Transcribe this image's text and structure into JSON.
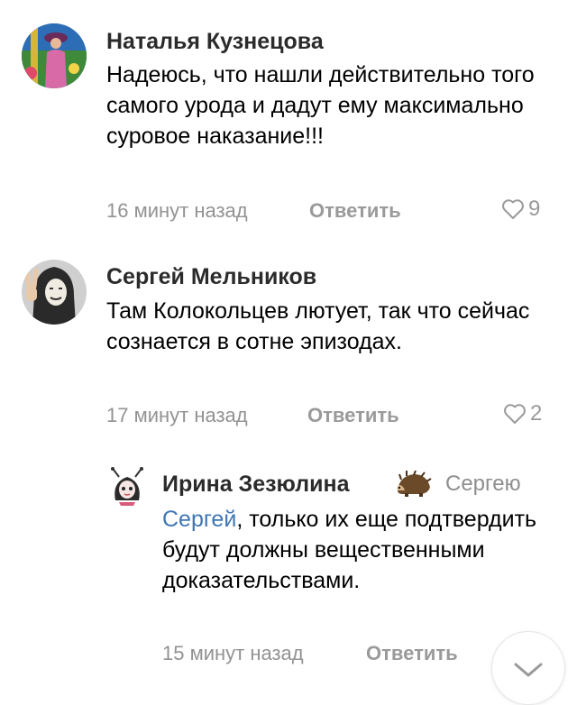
{
  "comments": [
    {
      "author": "Наталья Кузнецова",
      "text": "Надеюсь, что нашли действительно того самого урода и дадут ему максимально суровое наказание!!!",
      "time": "16 минут назад",
      "reply_label": "Ответить",
      "likes": "9"
    },
    {
      "author": "Сергей Мельников",
      "text": "Там Колокольцев лютует, так что сейчас сознается в сотне эпизодах.",
      "time": "17 минут назад",
      "reply_label": "Ответить",
      "likes": "2"
    }
  ],
  "reply": {
    "author": "Ирина Зезюлина",
    "reply_to": "Сергею",
    "mention": "Сергей",
    "text": ", только их еще подтвердить будут должны вещественными доказательствами.",
    "time": "15 минут назад",
    "reply_label": "Ответить"
  },
  "icons": {
    "like": "heart-outline-icon",
    "scroll": "chevron-down-icon",
    "badge": "hedgehog-icon"
  },
  "colors": {
    "mention": "#3f76b5",
    "meta": "#929292",
    "name": "#2b2b2b"
  }
}
